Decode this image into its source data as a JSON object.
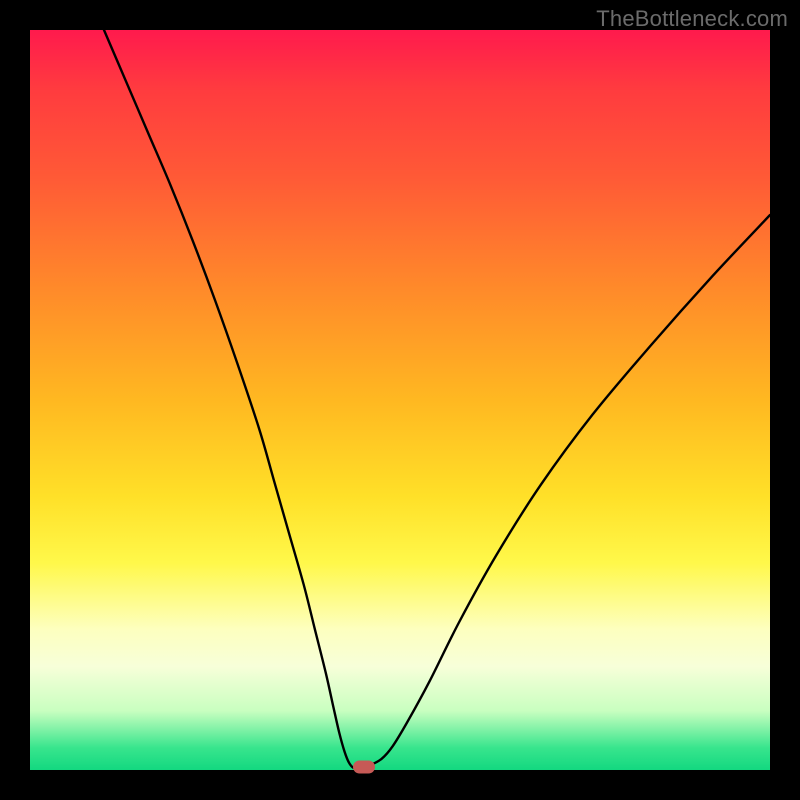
{
  "watermark": "TheBottleneck.com",
  "chart_data": {
    "type": "line",
    "title": "",
    "xlabel": "",
    "ylabel": "",
    "xlim": [
      0,
      100
    ],
    "ylim": [
      0,
      100
    ],
    "series": [
      {
        "name": "curve",
        "x": [
          10,
          13,
          16,
          19,
          22,
          25,
          28,
          31,
          33,
          35,
          37,
          38.5,
          40,
          41,
          41.8,
          42.5,
          43.1,
          43.7,
          44.4,
          45.8,
          47.5,
          49,
          51,
          54,
          58,
          63,
          69,
          76,
          84,
          92,
          100
        ],
        "y": [
          100,
          93,
          86,
          79,
          71.5,
          63.5,
          55,
          46,
          39,
          32,
          25,
          19,
          13,
          8.5,
          5,
          2.5,
          1,
          0.3,
          0.3,
          0.6,
          1.5,
          3.2,
          6.5,
          12,
          20,
          29,
          38.5,
          48,
          57.5,
          66.5,
          75
        ]
      }
    ],
    "marker": {
      "x": 45.1,
      "y": 0.45,
      "color": "#c65a56"
    },
    "background_gradient": {
      "stops": [
        {
          "pos": 0,
          "color": "#ff1a4d"
        },
        {
          "pos": 8,
          "color": "#ff3b3f"
        },
        {
          "pos": 20,
          "color": "#ff5a36"
        },
        {
          "pos": 35,
          "color": "#ff8a2a"
        },
        {
          "pos": 50,
          "color": "#ffb821"
        },
        {
          "pos": 63,
          "color": "#ffe028"
        },
        {
          "pos": 72,
          "color": "#fff84a"
        },
        {
          "pos": 81,
          "color": "#fdffbf"
        },
        {
          "pos": 86,
          "color": "#f7ffd9"
        },
        {
          "pos": 92,
          "color": "#c9ffc0"
        },
        {
          "pos": 97,
          "color": "#38e58d"
        },
        {
          "pos": 100,
          "color": "#13d880"
        }
      ]
    }
  }
}
